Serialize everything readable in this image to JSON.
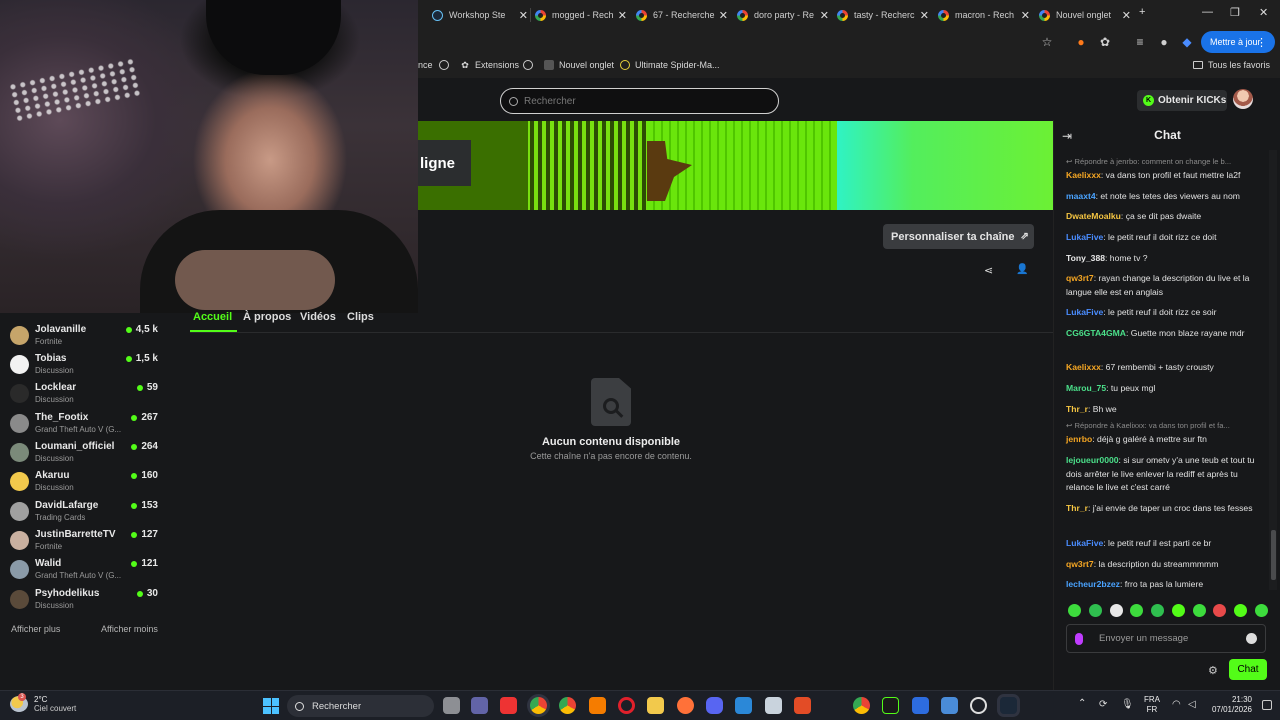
{
  "browser": {
    "tabs": [
      {
        "label": "Workshop Ste",
        "icon": "steam-icon"
      },
      {
        "label": "mogged - Rech",
        "icon": "google-icon"
      },
      {
        "label": "67 - Recherche",
        "icon": "google-icon"
      },
      {
        "label": "doro party - Re",
        "icon": "google-icon"
      },
      {
        "label": "tasty - Recherc",
        "icon": "google-icon"
      },
      {
        "label": "macron - Rech",
        "icon": "google-icon"
      },
      {
        "label": "Nouvel onglet",
        "icon": "google-icon"
      }
    ],
    "update_button": "Mettre à jour",
    "bookmarks": {
      "partial": "nce",
      "extensions": "Extensions",
      "new_tab": "Nouvel onglet",
      "spiderman": "Ultimate Spider-Ma...",
      "all_favorites": "Tous les favoris"
    }
  },
  "header": {
    "search_placeholder": "Rechercher",
    "kicks_button": "Obtenir KICKs"
  },
  "banner": {
    "label": "ligne"
  },
  "channel": {
    "customize_button": "Personnaliser ta chaîne",
    "tabs": [
      "Accueil",
      "À propos",
      "Vidéos",
      "Clips"
    ],
    "empty_title": "Aucun contenu disponible",
    "empty_subtitle": "Cette chaîne n'a pas encore de contenu."
  },
  "sidebar": {
    "channels": [
      {
        "name": "Jolavanille",
        "category": "Fortnite",
        "viewers": "4,5 k",
        "color": "#c6a56a"
      },
      {
        "name": "Tobias",
        "category": "Discussion",
        "viewers": "1,5 k",
        "color": "#f2f2f2"
      },
      {
        "name": "Locklear",
        "category": "Discussion",
        "viewers": "59",
        "color": "#2a2a2a"
      },
      {
        "name": "The_Footix",
        "category": "Grand Theft Auto V (G...",
        "viewers": "267",
        "color": "#8a8a8a"
      },
      {
        "name": "Loumani_officiel",
        "category": "Discussion",
        "viewers": "264",
        "color": "#7b8a7a"
      },
      {
        "name": "Akaruu",
        "category": "Discussion",
        "viewers": "160",
        "color": "#f2c94c"
      },
      {
        "name": "DavidLafarge",
        "category": "Trading Cards",
        "viewers": "153",
        "color": "#a0a0a0"
      },
      {
        "name": "JustinBarretteTV",
        "category": "Fortnite",
        "viewers": "127",
        "color": "#c9b0a0"
      },
      {
        "name": "Walid",
        "category": "Grand Theft Auto V (G...",
        "viewers": "121",
        "color": "#8a9aa8"
      },
      {
        "name": "Psyhodelikus",
        "category": "Discussion",
        "viewers": "30",
        "color": "#5a4a3a"
      }
    ],
    "show_more": "Afficher plus",
    "show_less": "Afficher moins"
  },
  "chat": {
    "title": "Chat",
    "messages": [
      {
        "type": "reply",
        "text": "Répondre à jenrbo: comment on change le b..."
      },
      {
        "user": "Kaelixxx",
        "color": "#f5a623",
        "text": "va dans ton profil et faut mettre la2f"
      },
      {
        "user": "maaxt4",
        "color": "#4aa3ff",
        "text": "et note les tetes des viewers au nom"
      },
      {
        "user": "DwateMoalku",
        "color": "#f5c542",
        "text": "ça se dit pas dwaite"
      },
      {
        "user": "LukaFive",
        "color": "#4a8cff",
        "text": "le petit reuf il doit rizz ce doit"
      },
      {
        "user": "Tony_388",
        "color": "#e8e8e8",
        "text": "home tv ?"
      },
      {
        "user": "qw3rt7",
        "color": "#f5a623",
        "text": "rayan change la description du live et la langue elle est en anglais"
      },
      {
        "user": "LukaFive",
        "color": "#4a8cff",
        "text": "le petit reuf il doit rizz ce soir"
      },
      {
        "user": "CG6GTA4GMA",
        "color": "#4be08a",
        "text": "Guette mon blaze rayane mdr"
      },
      {
        "user": "Kaelixxx",
        "color": "#f5a623",
        "text": "67 rembembi + tasty crousty"
      },
      {
        "user": "Marou_75",
        "color": "#4be08a",
        "text": "tu peux mgl"
      },
      {
        "user": "Thr_r",
        "color": "#f5c542",
        "text": "Bh we"
      },
      {
        "type": "reply",
        "text": "Répondre à Kaelixxx: va dans ton profil et fa..."
      },
      {
        "user": "jenrbo",
        "color": "#f5a623",
        "text": "déjà g galéré à mettre sur ftn"
      },
      {
        "user": "lejoueur0000",
        "color": "#4be08a",
        "text": "si sur ometv y'a une teub et tout tu dois arrêter le live enlever la rediff et après tu relance le live et c'est carré"
      },
      {
        "user": "Thr_r",
        "color": "#f5c542",
        "text": "j'ai envie de taper un croc dans tes fesses"
      },
      {
        "user": "LukaFive",
        "color": "#4a8cff",
        "text": "le petit reuf il est parti ce br"
      },
      {
        "user": "qw3rt7",
        "color": "#f5a623",
        "text": "la description du streammmmm"
      },
      {
        "user": "lecheur2bzez",
        "color": "#4aa3ff",
        "text": "frro ta pas la lumiere"
      }
    ],
    "input_placeholder": "Envoyer un message",
    "send_button": "Chat"
  },
  "taskbar": {
    "temperature": "2°C",
    "condition": "Ciel couvert",
    "weather_badge": "3",
    "search": "Rechercher",
    "lang_line1": "FRA",
    "lang_line2": "FR",
    "time": "21:30",
    "date": "07/01/2026"
  }
}
